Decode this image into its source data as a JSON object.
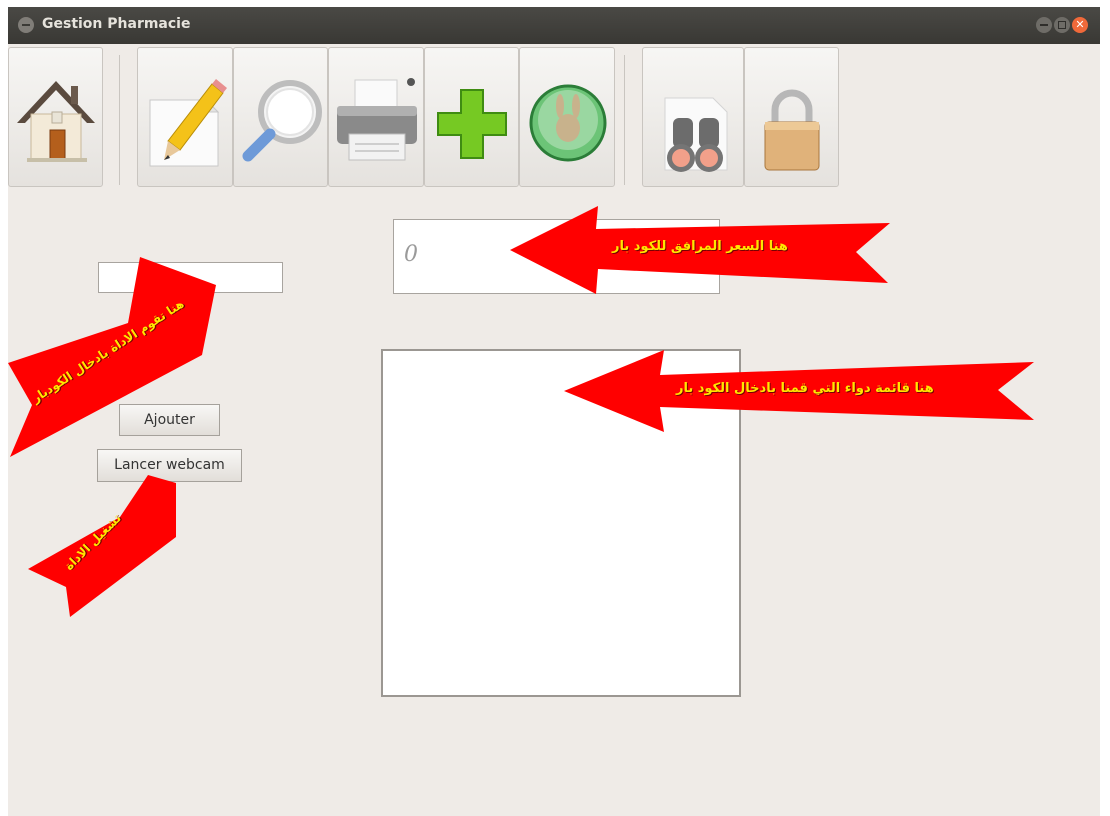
{
  "window": {
    "title": "Gestion Pharmacie",
    "close_glyph": "✕"
  },
  "toolbar": {
    "buttons": [
      {
        "icon": "home-icon"
      },
      {
        "icon": "edit-document-icon"
      },
      {
        "icon": "search-icon"
      },
      {
        "icon": "printer-icon"
      },
      {
        "icon": "add-icon"
      },
      {
        "icon": "mascot-icon"
      },
      {
        "icon": "binoculars-icon"
      },
      {
        "icon": "lock-icon"
      }
    ]
  },
  "form": {
    "barcode_value": "",
    "price_value": "0",
    "add_button": "Ajouter",
    "webcam_button": "Lancer webcam"
  },
  "annotations": {
    "price_note": "هنا السعر المرافق للكود بار",
    "list_note": "هنا قائمة دواء التي قمنا بادخال الكود بار",
    "barcode_note": "هنا تقوم الاداة بادخال الكودبار",
    "webcam_note": "تشغيل الاداة",
    "arrow_color": "#ff0000",
    "text_color": "#ffe600"
  }
}
